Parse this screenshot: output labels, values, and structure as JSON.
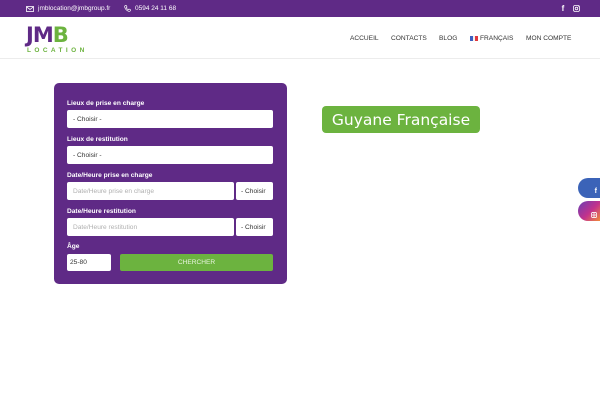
{
  "topbar": {
    "email": "jmblocation@jmbgroup.fr",
    "phone": "0594 24 11 68",
    "social": [
      {
        "icon": "facebook-icon",
        "glyph": "f"
      },
      {
        "icon": "instagram-icon"
      }
    ]
  },
  "logo": {
    "main_left": "JM",
    "main_right": "B",
    "sub": "LOCATION"
  },
  "nav": {
    "items": [
      "ACCUEIL",
      "CONTACTS",
      "BLOG",
      "FRANÇAIS",
      "MON COMPTE"
    ],
    "active": "ACCUEIL"
  },
  "form": {
    "pickup_label": "Lieux de prise en charge",
    "pickup_value": "- Choisir -",
    "return_label": "Lieux de restitution",
    "return_value": "- Choisir -",
    "pickup_dt_label": "Date/Heure prise en charge",
    "pickup_dt_placeholder": "Date/Heure prise en charge",
    "pickup_time_value": "- Choisir",
    "return_dt_label": "Date/Heure restitution",
    "return_dt_placeholder": "Date/Heure restitution",
    "return_time_value": "- Choisir",
    "age_label": "Âge",
    "age_value": "25-80",
    "search_label": "CHERCHER"
  },
  "banner": {
    "text": "Guyane Française"
  },
  "colors": {
    "brand_purple": "#5f2a86",
    "brand_green": "#6cb33f"
  }
}
